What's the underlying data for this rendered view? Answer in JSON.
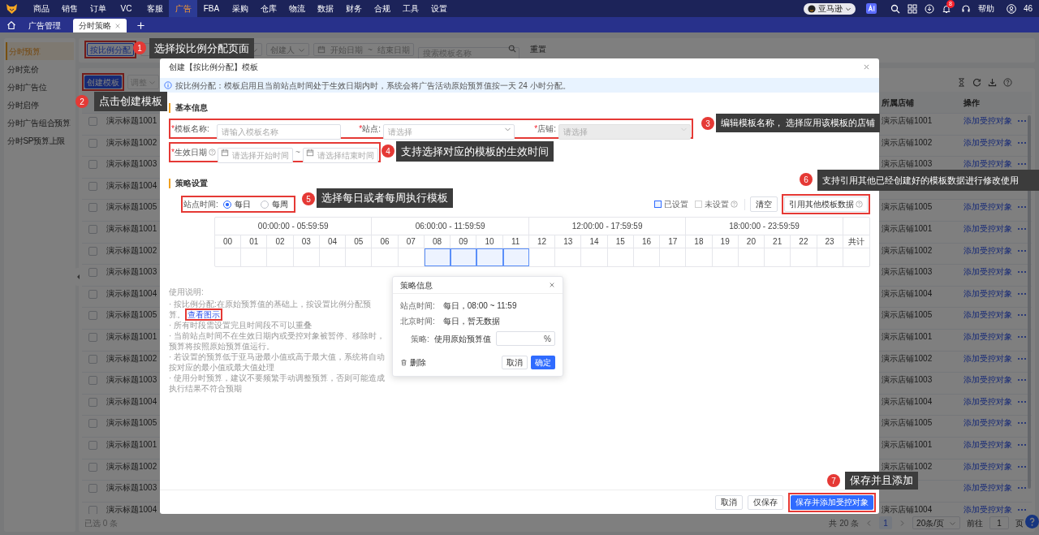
{
  "top_nav": {
    "menu": [
      {
        "label": "商品",
        "selected": false
      },
      {
        "label": "销售",
        "selected": false
      },
      {
        "label": "订单",
        "selected": false
      },
      {
        "label": "VC",
        "selected": false
      },
      {
        "label": "客服",
        "selected": false
      },
      {
        "label": "广告",
        "selected": true
      },
      {
        "label": "FBA",
        "selected": false
      },
      {
        "label": "采购",
        "selected": false
      },
      {
        "label": "仓库",
        "selected": false
      },
      {
        "label": "物流",
        "selected": false
      },
      {
        "label": "数据",
        "selected": false
      },
      {
        "label": "财务",
        "selected": false
      },
      {
        "label": "合规",
        "selected": false
      },
      {
        "label": "工具",
        "selected": false
      },
      {
        "label": "设置",
        "selected": false
      }
    ],
    "marketplace": "亚马逊",
    "notification_count": "8",
    "help": "帮助",
    "user": "46"
  },
  "tabs": [
    {
      "label": "广告管理",
      "selected": false,
      "closable": false
    },
    {
      "label": "分时策略",
      "selected": true,
      "closable": true
    }
  ],
  "sidebar": [
    {
      "label": "分时预算",
      "selected": true
    },
    {
      "label": "分时竞价",
      "selected": false
    },
    {
      "label": "分时广告位",
      "selected": false
    },
    {
      "label": "分时启停",
      "selected": false
    },
    {
      "label": "分时广告组合预算",
      "selected": false
    },
    {
      "label": "分时SP预算上限",
      "selected": false
    }
  ],
  "filters": {
    "mode_button": "按比例分配",
    "mode_highlighted": true,
    "creator": "创建人",
    "start_date": "开始日期",
    "date_separator": "~",
    "end_date": "结束日期",
    "search_placeholder": "搜索模板名称",
    "reset": "重置"
  },
  "toolbar": {
    "create_button": "创建模板",
    "create_highlighted": true,
    "adjust_button": "调整",
    "adjust_disabled": true
  },
  "table": {
    "columns": [
      "所属店铺",
      "操作"
    ],
    "rows": [
      {
        "title": "演示标题1001",
        "store": "演示店铺1001",
        "action": "添加受控对象",
        "checked": false
      },
      {
        "title": "演示标题1002",
        "store": "演示店铺1002",
        "action": "添加受控对象",
        "checked": false
      },
      {
        "title": "演示标题1003",
        "store": "演示店铺1003",
        "action": "添加受控对象",
        "checked": false
      },
      {
        "title": "演示标题1004",
        "checked": false
      },
      {
        "title": "演示标题1005",
        "store": "演示店铺1005",
        "action": "添加受控对象",
        "checked": false
      },
      {
        "title": "演示标题1001",
        "store": "演示店铺1001",
        "action": "添加受控对象",
        "checked": false
      },
      {
        "title": "演示标题1002",
        "store": "演示店铺1002",
        "action": "添加受控对象",
        "checked": false
      },
      {
        "title": "演示标题1003",
        "store": "演示店铺1003",
        "action": "添加受控对象",
        "checked": false
      },
      {
        "title": "演示标题1004",
        "store": "演示店铺1004",
        "action": "添加受控对象",
        "checked": false
      },
      {
        "title": "演示标题1005",
        "store": "演示店铺1005",
        "action": "添加受控对象",
        "checked": false
      },
      {
        "title": "演示标题1001",
        "store": "演示店铺1001",
        "action": "添加受控对象",
        "checked": false
      },
      {
        "title": "演示标题1002",
        "store": "演示店铺1002",
        "action": "添加受控对象",
        "checked": false
      },
      {
        "title": "演示标题1003",
        "store": "演示店铺1003",
        "action": "添加受控对象",
        "checked": false
      },
      {
        "title": "演示标题1004",
        "store": "演示店铺1004",
        "action": "添加受控对象",
        "checked": false
      },
      {
        "title": "演示标题1005",
        "store": "演示店铺1005",
        "action": "添加受控对象",
        "checked": false
      },
      {
        "title": "演示标题1001",
        "store": "演示店铺1001",
        "action": "添加受控对象",
        "checked": false
      },
      {
        "title": "演示标题1002",
        "store": "演示店铺1002",
        "action": "添加受控对象",
        "checked": false
      },
      {
        "title": "演示标题1003",
        "action": "添加受控对象",
        "checked": false
      },
      {
        "title": "演示标题1004",
        "store": "演示店铺1004",
        "action": "添加受控对象",
        "checked": false
      }
    ]
  },
  "selection_summary": "已选 0 条",
  "pagination": {
    "total": "共 20 条",
    "pages": [
      {
        "label": "1",
        "selected": true
      }
    ],
    "page_size": "20条/页",
    "goto_label": "前往",
    "goto_value": "1",
    "page_suffix": "页"
  },
  "modal": {
    "title": "创建【按比例分配】模板",
    "info": "按比例分配：模板启用且当前站点时间处于生效日期内时，系统会将广告活动原始预算值按一天 24 小时分配。",
    "basic_section": "基本信息",
    "fields_highlighted": true,
    "fields": [
      {
        "kind": "input",
        "required_mark": "*",
        "label": "模板名称:",
        "placeholder": "请输入模板名称",
        "disabled": false
      },
      {
        "kind": "select",
        "required_mark": "*",
        "label": "站点:",
        "placeholder": "请选择",
        "disabled": false
      },
      {
        "kind": "select",
        "required_mark": "*",
        "label": "店铺:",
        "placeholder": "请选择",
        "disabled": true
      }
    ],
    "effective_date": {
      "required_mark": "*",
      "label": "生效日期",
      "start_placeholder": "请选择开始时间",
      "separator": "~",
      "end_placeholder": "请选择结束时间",
      "highlighted": true
    },
    "strategy_section": "策略设置",
    "schedule": {
      "label": "站点时间:",
      "highlighted": true,
      "options": [
        {
          "label": "每日",
          "selected": true
        },
        {
          "label": "每周",
          "selected": false
        }
      ]
    },
    "legend": [
      {
        "kind": "set",
        "label": "已设置"
      },
      {
        "kind": "unset",
        "label": "未设置"
      }
    ],
    "clear_button": "清空",
    "import_button": "引用其他模板数据",
    "import_highlighted": true,
    "grid": {
      "groups": [
        "00:00:00 - 05:59:59",
        "06:00:00 - 11:59:59",
        "12:00:00 - 17:59:59",
        "18:00:00 - 23:59:59"
      ],
      "total_label": "共计",
      "hours": [
        {
          "label": "00",
          "selected": false
        },
        {
          "label": "01",
          "selected": false
        },
        {
          "label": "02",
          "selected": false
        },
        {
          "label": "03",
          "selected": false
        },
        {
          "label": "04",
          "selected": false
        },
        {
          "label": "05",
          "selected": false
        },
        {
          "label": "06",
          "selected": false
        },
        {
          "label": "07",
          "selected": false
        },
        {
          "label": "08",
          "selected": true
        },
        {
          "label": "09",
          "selected": true
        },
        {
          "label": "10",
          "selected": true
        },
        {
          "label": "11",
          "selected": true
        },
        {
          "label": "12",
          "selected": false
        },
        {
          "label": "13",
          "selected": false
        },
        {
          "label": "14",
          "selected": false
        },
        {
          "label": "15",
          "selected": false
        },
        {
          "label": "16",
          "selected": false
        },
        {
          "label": "17",
          "selected": false
        },
        {
          "label": "18",
          "selected": false
        },
        {
          "label": "19",
          "selected": false
        },
        {
          "label": "20",
          "selected": false
        },
        {
          "label": "21",
          "selected": false
        },
        {
          "label": "22",
          "selected": false
        },
        {
          "label": "23",
          "selected": false
        }
      ]
    },
    "usage": {
      "title": "使用说明:",
      "items": [
        {
          "text": "· 按比例分配:在原始预算值的基础上，按设置比例分配预算。",
          "link": "查看图示",
          "link_highlighted": true
        },
        {
          "text": "· 所有时段需设置完且时间段不可以重叠"
        },
        {
          "text": "· 当前站点时间不在生效日期内或受控对象被暂停、移除时，预算将按照原始预算值运行。"
        },
        {
          "text": "· 若设置的预算低于亚马逊最小值或高于最大值，系统将自动按对应的最小值或最大值处理"
        },
        {
          "text": "· 使用分时预算，建议不要频繁手动调整预算，否则可能造成执行结果不符合预期"
        }
      ]
    },
    "popover": {
      "title": "策略信息",
      "rows": [
        {
          "label": "站点时间:",
          "value": "每日，08:00 ~ 11:59"
        },
        {
          "label": "北京时间:",
          "value": "每日，暂无数据"
        }
      ],
      "strategy_label": "策略:",
      "strategy_prefix": "使用原始预算值",
      "unit": "%",
      "delete": "删除",
      "cancel": "取消",
      "confirm": "确定"
    },
    "footer": {
      "cancel": "取消",
      "save_only": "仅保存",
      "save_and_add": "保存并添加受控对象",
      "save_and_add_highlighted": true
    }
  },
  "annotations": [
    {
      "number": "1",
      "text": "选择按比例分配页面"
    },
    {
      "number": "2",
      "text": "点击创建模板"
    },
    {
      "number": "3",
      "text": "编辑模板名称， 选择应用该模板的店铺"
    },
    {
      "number": "4",
      "text": "支持选择对应的模板的生效时间"
    },
    {
      "number": "5",
      "text": "选择每日或者每周执行模板"
    },
    {
      "number": "6",
      "text": "支持引用其他已经创建好的模板数据进行修改使用"
    },
    {
      "number": "7",
      "text": "保存并且添加"
    }
  ]
}
